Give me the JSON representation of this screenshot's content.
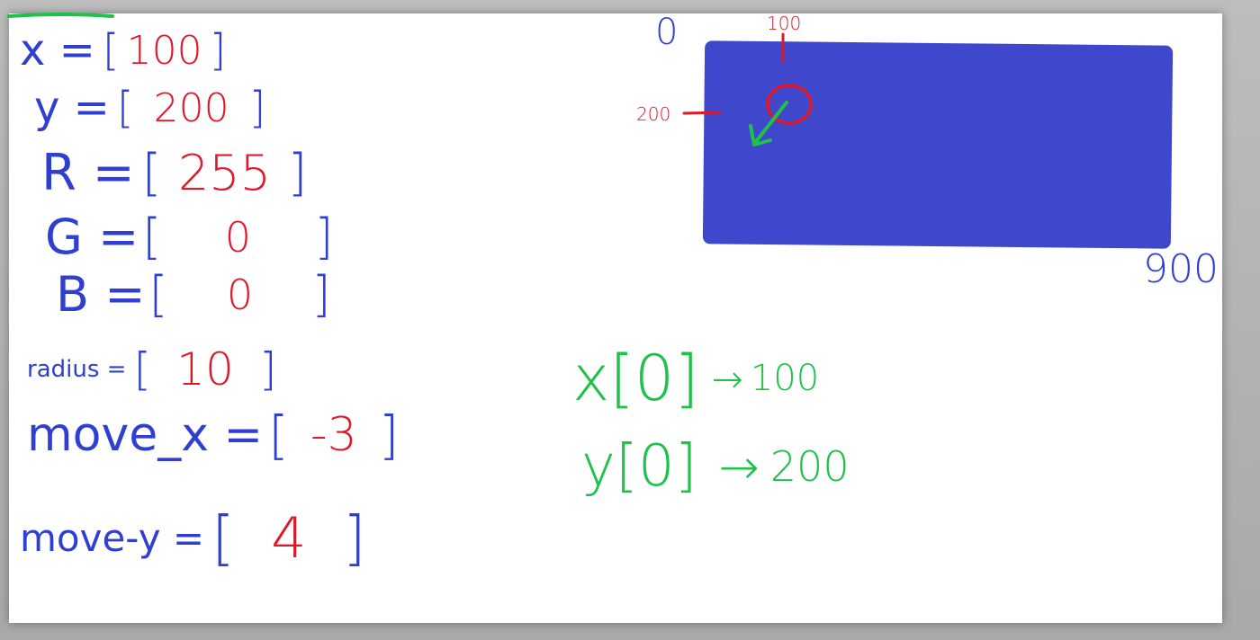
{
  "variables": [
    {
      "name": "x =",
      "value": "100"
    },
    {
      "name": "y =",
      "value": "200"
    },
    {
      "name": "R =",
      "value": "255"
    },
    {
      "name": "G =",
      "value": "0"
    },
    {
      "name": "B =",
      "value": "0"
    },
    {
      "name": "radius =",
      "value": "10"
    },
    {
      "name": "move_x =",
      "value": "-3"
    },
    {
      "name": "move-y =",
      "value": "4"
    }
  ],
  "canvas": {
    "origin_label": "0",
    "x_tick_label": "100",
    "y_tick_label": "200",
    "corner_label": "900",
    "fill_color": "#3f48cc"
  },
  "notes": {
    "x_line_text": "x[0]",
    "x_line_result": "100",
    "y_line_text": "y[0]",
    "y_line_result": "200",
    "arrow_glyph": "→"
  },
  "colors": {
    "ink_blue": "#2f3fcf",
    "ink_red": "#e0192a",
    "ink_green": "#1ec24a",
    "board": "#ffffff"
  }
}
